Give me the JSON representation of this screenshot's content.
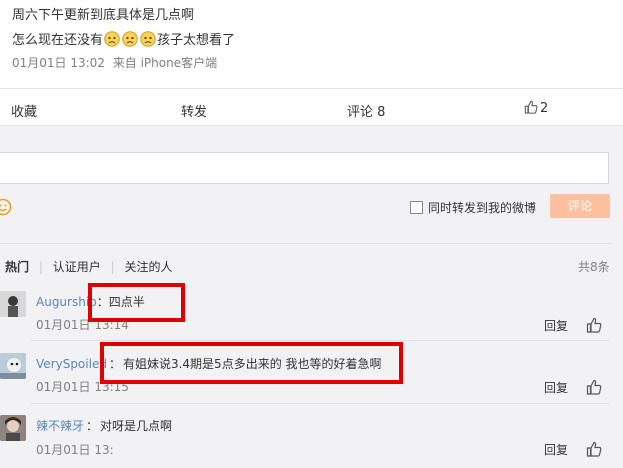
{
  "post": {
    "line1": "周六下午更新到底具体是几点啊",
    "line2_prefix": "怎么现在还没有",
    "line2_suffix": "孩子太想看了",
    "time": "01月01日 13:02",
    "source": "来自 iPhone客户端"
  },
  "actions": {
    "favorite": "收藏",
    "repost": "转发",
    "comment": "评论 8",
    "like_count": "2"
  },
  "composer": {
    "input_placeholder": "",
    "also_repost_label": "同时转发到我的微博",
    "submit_label": "评论"
  },
  "filters": {
    "tabs": [
      "热门",
      "认证用户",
      "关注的人"
    ],
    "total": "共8条"
  },
  "comments": [
    {
      "user": "Augurship",
      "sep": "：",
      "text": "四点半",
      "time": "01月01日 13:14",
      "reply": "回复"
    },
    {
      "user": "VerySpoiled",
      "sep": "：",
      "text": "有姐妹说3.4期是5点多出来的 我也等的好着急啊",
      "time": "01月01日 13:15",
      "reply": "回复"
    },
    {
      "user": "辣不辣牙",
      "sep": "：",
      "text": "对呀是几点啊",
      "time": "01月01日 13:",
      "reply": "回复"
    }
  ],
  "colors": {
    "link": "#5a86b4",
    "submit_bg": "#ffc09f",
    "highlight_box": "#e00000"
  },
  "icons": [
    "sad-emoji-icon",
    "thumb-up-icon",
    "smiley-icon",
    "checkbox-icon"
  ]
}
